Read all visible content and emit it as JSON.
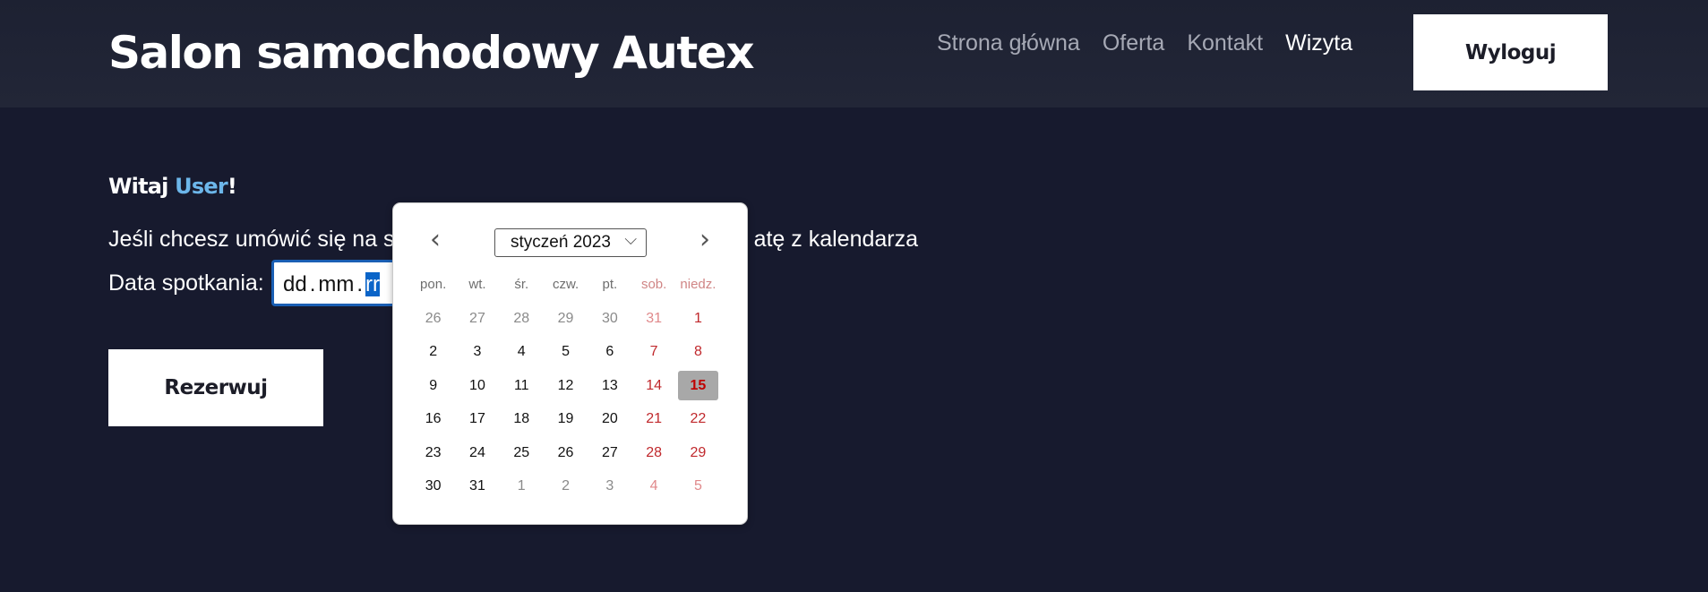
{
  "header": {
    "title": "Salon samochodowy Autex",
    "nav": [
      "Strona główna",
      "Oferta",
      "Kontakt",
      "Wizyta"
    ],
    "active_nav": "Wizyta",
    "logout_label": "Wyloguj"
  },
  "main": {
    "greeting_prefix": "Witaj",
    "user_name": "User",
    "greeting_suffix": "!",
    "instructions_visible_start": "Jeśli chcesz umówić się na s",
    "instructions_visible_end": "atę z kalendarza",
    "date_label": "Data spotkania:",
    "date_input": {
      "day": "dd",
      "sep": ".",
      "month": "mm",
      "year_selected": "rr"
    },
    "reserve_label": "Rezerwuj"
  },
  "datepicker": {
    "month_label": "styczeń 2023",
    "weekdays": [
      "pon.",
      "wt.",
      "śr.",
      "czw.",
      "pt.",
      "sob.",
      "niedz."
    ],
    "weeks": [
      [
        "26",
        "27",
        "28",
        "29",
        "30",
        "31",
        "1"
      ],
      [
        "2",
        "3",
        "4",
        "5",
        "6",
        "7",
        "8"
      ],
      [
        "9",
        "10",
        "11",
        "12",
        "13",
        "14",
        "15"
      ],
      [
        "16",
        "17",
        "18",
        "19",
        "20",
        "21",
        "22"
      ],
      [
        "23",
        "24",
        "25",
        "26",
        "27",
        "28",
        "29"
      ],
      [
        "30",
        "31",
        "1",
        "2",
        "3",
        "4",
        "5"
      ]
    ],
    "today": "15",
    "colors": {
      "weekend": "#c0282c",
      "today_bg": "#a8a8a8",
      "accent": "#0a64c8"
    }
  }
}
